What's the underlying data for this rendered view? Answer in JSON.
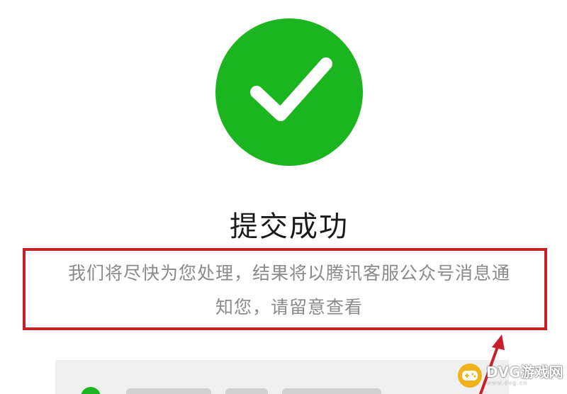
{
  "status": {
    "title": "提交成功",
    "message_line1": "我们将尽快为您处理，结果将以腾讯客服公众号消息通",
    "message_line2": "知您，请留意查看"
  },
  "icons": {
    "success": "checkmark-circle-icon",
    "annotation_arrow": "red-arrow-icon",
    "watermark_logo": "gamepad-icon"
  },
  "watermark": {
    "main": "DVG游戏网",
    "sub": "www.dvg.cn"
  },
  "colors": {
    "success_green": "#1bb520",
    "highlight_red": "#c8202a",
    "message_gray": "#8a8a8a",
    "watermark_gold": "#f2b21a"
  }
}
